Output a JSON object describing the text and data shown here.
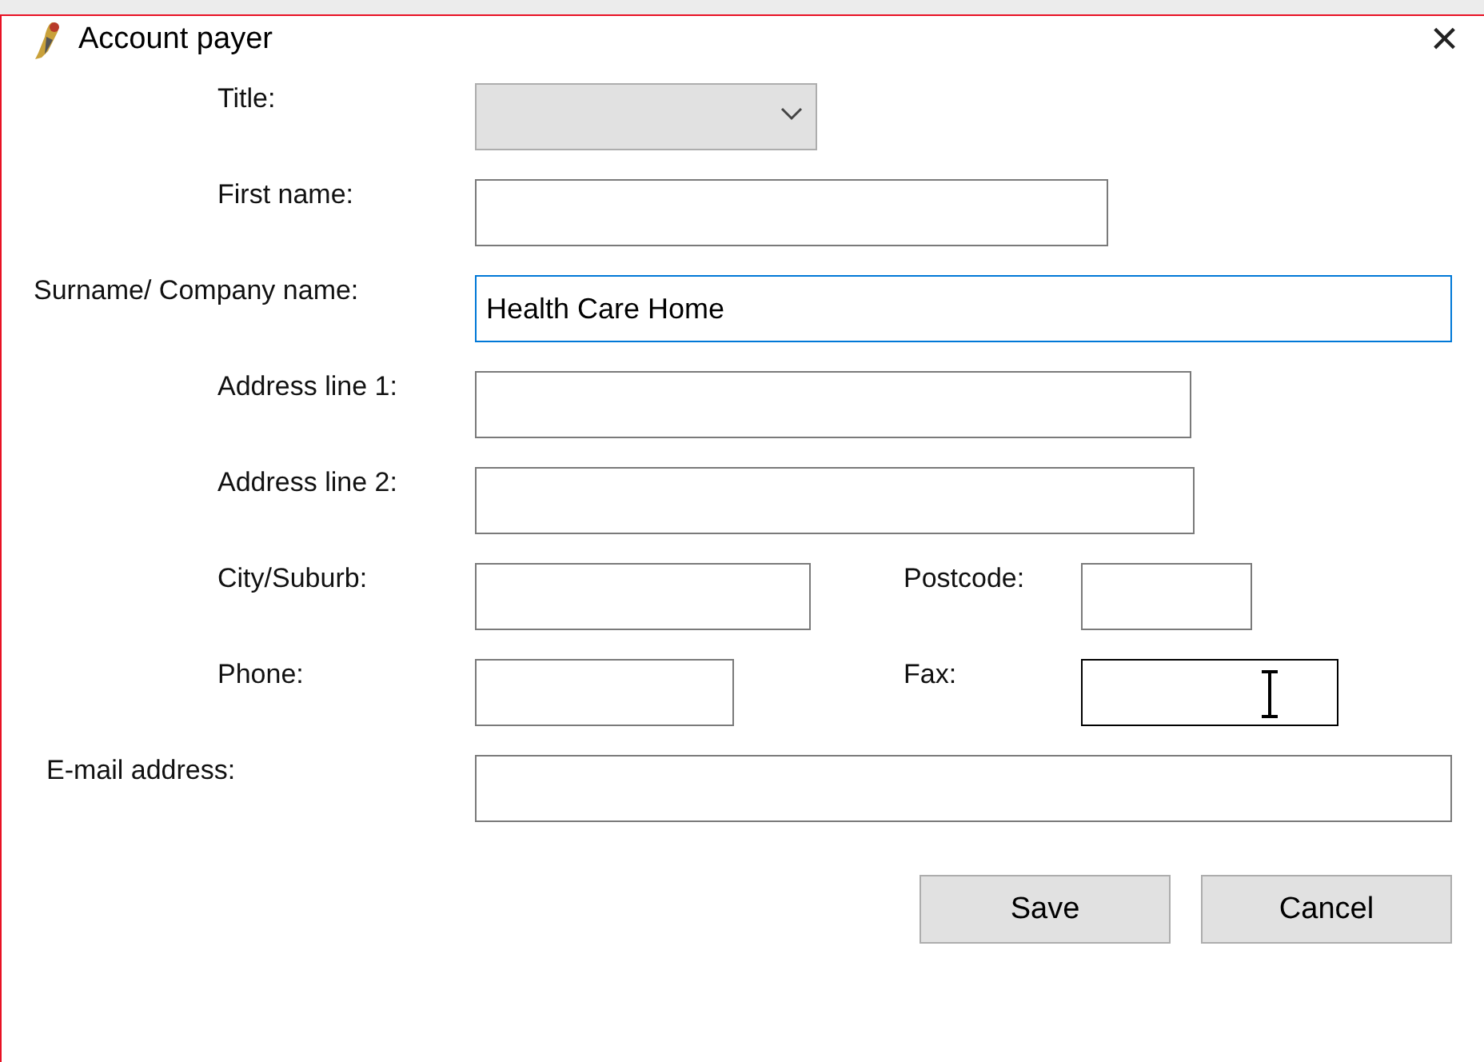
{
  "window": {
    "title": "Account payer",
    "close": "×"
  },
  "fields": [
    {
      "label": "Title:",
      "kind": "dropdown",
      "disabled": true,
      "focused": false,
      "hovered": false
    },
    {
      "label": "First name:",
      "kind": "text",
      "disabled": false,
      "focused": false,
      "hovered": false
    },
    {
      "label": "Surname/ Company name:",
      "kind": "text",
      "value": "Health Care Home",
      "disabled": false,
      "focused": true,
      "hovered": false
    },
    {
      "label": "Address line 1:",
      "kind": "text",
      "disabled": false,
      "focused": false,
      "hovered": false
    },
    {
      "label": "Address line 2:",
      "kind": "text",
      "disabled": false,
      "focused": false,
      "hovered": false
    },
    {
      "label": "City/Suburb:",
      "kind": "text",
      "disabled": false,
      "focused": false,
      "hovered": false
    },
    {
      "label": "Postcode:",
      "kind": "text",
      "disabled": false,
      "focused": false,
      "hovered": false
    },
    {
      "label": "Phone:",
      "kind": "text",
      "disabled": false,
      "focused": false,
      "hovered": false
    },
    {
      "label": "Fax:",
      "kind": "text",
      "disabled": false,
      "focused": false,
      "hovered": true
    },
    {
      "label": "E-mail address:",
      "kind": "text",
      "disabled": false,
      "focused": false,
      "hovered": false
    }
  ],
  "buttons": [
    "Save",
    "Cancel"
  ]
}
